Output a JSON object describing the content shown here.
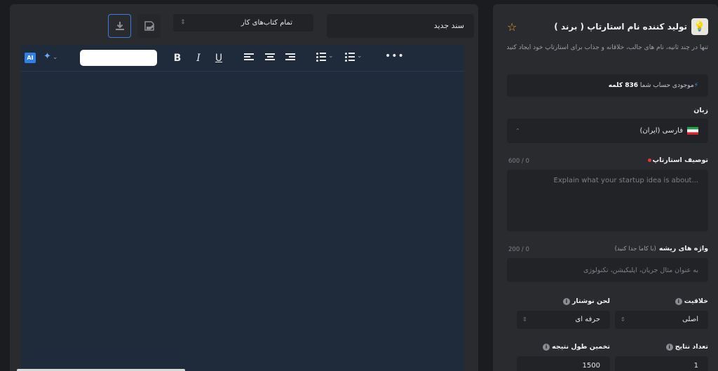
{
  "editor": {
    "doc_name": "سند جدید",
    "workbook_select": "تمام کتاب‌های کار",
    "toolbar": {
      "ai_badge": "AI",
      "bold": "B",
      "italic": "I",
      "underline": "U",
      "more": "•••"
    }
  },
  "form": {
    "title": "تولید کننده نام استارتاپ ( برند )",
    "description": "تنها در چند ثانیه، نام های جالب، خلاقانه و جذاب برای استارتاپ خود ایجاد کنید",
    "balance_prefix": "موجودی حساب شما",
    "balance_value": "836 کلمه",
    "language_label": "زبان",
    "language_value": "فارسی (ایران)",
    "startup_desc_label": "توصیف استارتاپ",
    "startup_desc_counter": "600 / 0",
    "startup_desc_placeholder": "Explain what your startup idea is about...",
    "keywords_label": "واژه های ریشه",
    "keywords_hint": "(با کاما جدا کنید)",
    "keywords_counter": "200 / 0",
    "keywords_placeholder": "به عنوان مثال جریان، اپلیکیشن، تکنولوژی",
    "creativity_label": "خلاقیت",
    "creativity_value": "اصلی",
    "tone_label": "لحن نوشتار",
    "tone_value": "حرفه ای",
    "results_count_label": "تعداد نتایج",
    "results_count_value": "1",
    "length_label": "تخمین طول نتیجه",
    "length_value": "1500"
  }
}
